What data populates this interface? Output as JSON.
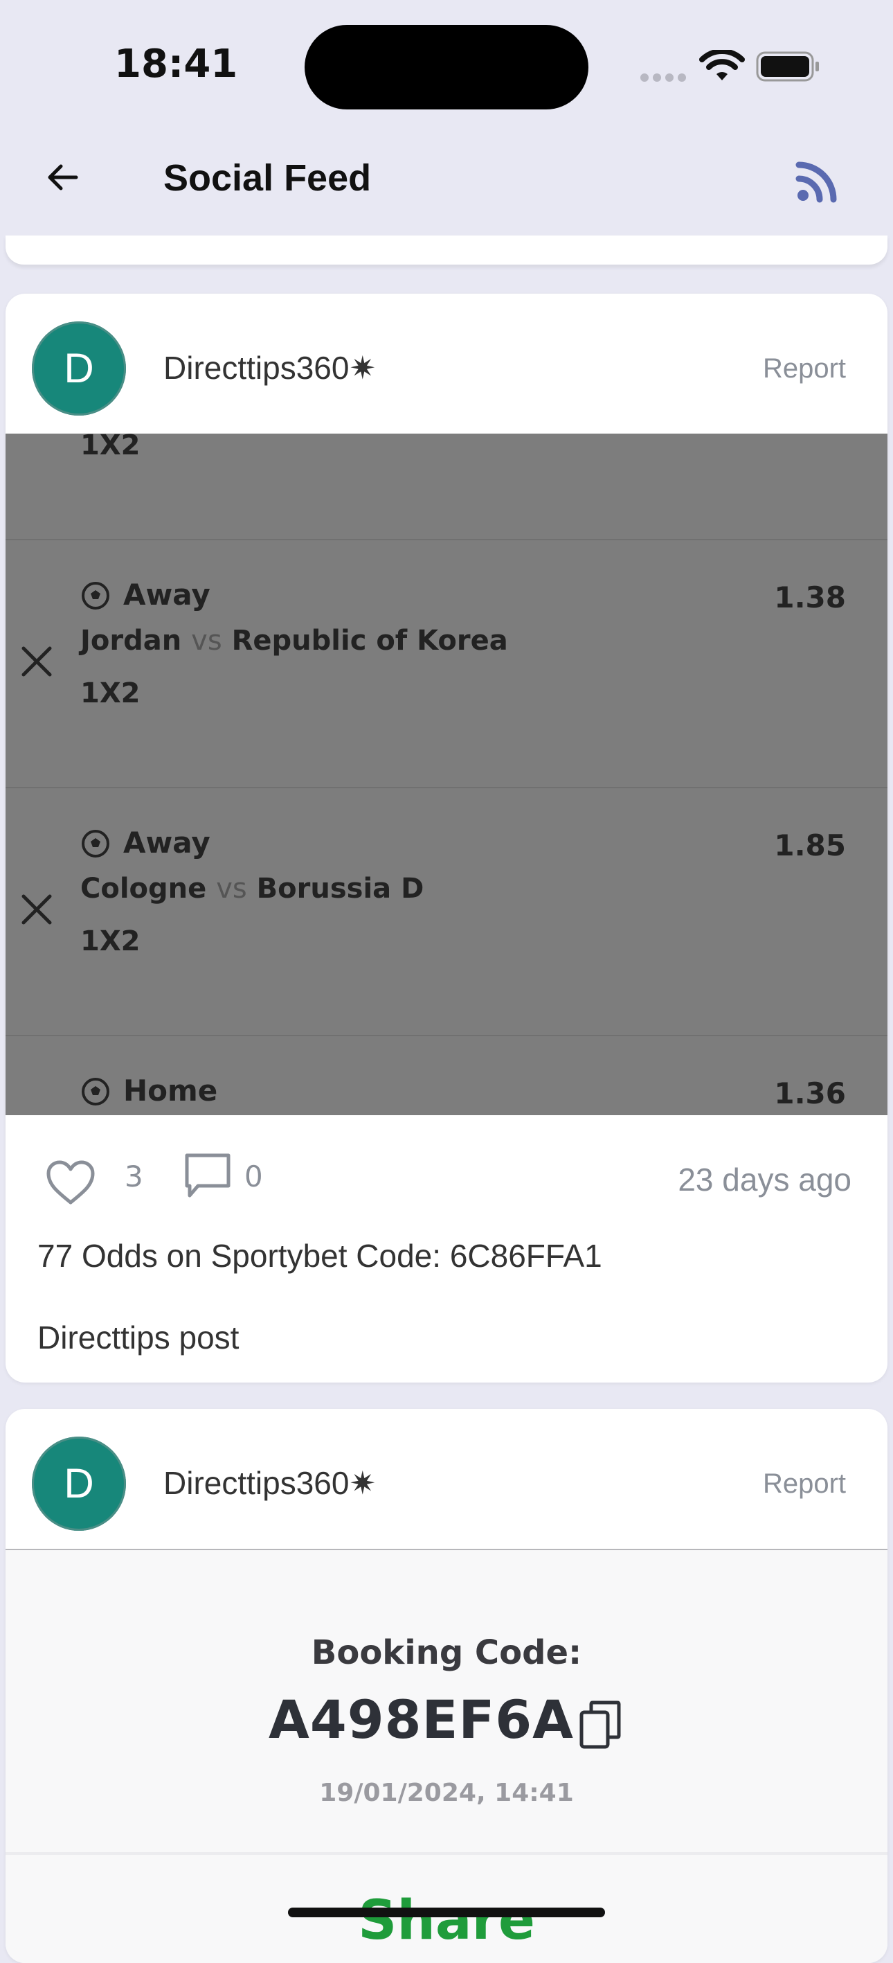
{
  "status": {
    "time": "18:41"
  },
  "header": {
    "title": "Social Feed",
    "back_icon": "arrow-left-icon",
    "rss_icon": "rss-icon"
  },
  "colors": {
    "avatar": "#17877a",
    "accent_rss": "#5a6ab0",
    "share_green": "#1f9c3b",
    "bet_overlay": "#7d7d7d"
  },
  "posts": [
    {
      "avatar_letter": "D",
      "username": "Directtips360✷",
      "report_label": "Report",
      "bets_partial_market": "1X2",
      "bets": [
        {
          "pick": "Away",
          "home": "Jordan",
          "vs": "vs",
          "away": "Republic of Korea",
          "market": "1X2",
          "odds": "1.38"
        },
        {
          "pick": "Away",
          "home": "Cologne",
          "vs": "vs",
          "away": "Borussia D",
          "market": "1X2",
          "odds": "1.85"
        },
        {
          "pick": "Home",
          "home": "",
          "vs": "",
          "away": "",
          "market": "",
          "odds": "1.36"
        }
      ],
      "likes": "3",
      "comments": "0",
      "time_ago": "23 days ago",
      "caption": "77 Odds on Sportybet Code: 6C86FFA1",
      "post_type": "Directtips post"
    },
    {
      "avatar_letter": "D",
      "username": "Directtips360✷",
      "report_label": "Report",
      "booking_label": "Booking Code:",
      "booking_code": "A498EF6A",
      "booking_date": "19/01/2024, 14:41",
      "share_label": "Share"
    }
  ]
}
